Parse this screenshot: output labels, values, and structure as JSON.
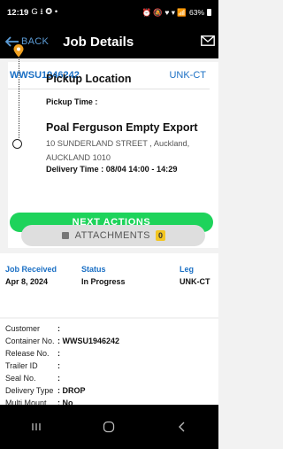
{
  "statusbar": {
    "time": "12:19",
    "left_icons": "G ⭳ ✪ •",
    "right_icons": "⏰ 🔕 ♥ ▾ 📶",
    "battery": "63%"
  },
  "appbar": {
    "back_label": "BACK",
    "title": "Job Details",
    "mail_icon": "mail-icon"
  },
  "job": {
    "number": "WWSU1946242",
    "leg": "UNK-CT"
  },
  "pickup": {
    "title": "Pickup Location",
    "time_label": "Pickup Time :"
  },
  "delivery": {
    "name": "Poal Ferguson Empty Export",
    "address": "10 SUNDERLAND STREET , Auckland, AUCKLAND 1010",
    "time_label": "Delivery Time : ",
    "time_value": "08/04 14:00 - 14:29"
  },
  "buttons": {
    "next_actions": "NEXT ACTIONS",
    "attachments": "ATTACHMENTS",
    "attachments_count": "0"
  },
  "summary": {
    "received_label": "Job Received",
    "received_value": "Apr 8, 2024",
    "status_label": "Status",
    "status_value": "In Progress",
    "leg_label": "Leg",
    "leg_value": "UNK-CT"
  },
  "details": [
    {
      "key": "Customer",
      "value": ":"
    },
    {
      "key": "Container No.",
      "value": ": WWSU1946242"
    },
    {
      "key": "Release No.",
      "value": ":"
    },
    {
      "key": "Trailer ID",
      "value": ":"
    },
    {
      "key": "Seal No.",
      "value": ":"
    },
    {
      "key": "Delivery Type",
      "value": ": DROP"
    },
    {
      "key": "Multi Mount.",
      "value": ": No"
    }
  ],
  "colors": {
    "accent_blue": "#1a6fc4",
    "green": "#1ed35b",
    "pin_orange": "#f0a020",
    "badge_yellow": "#f3c622"
  }
}
